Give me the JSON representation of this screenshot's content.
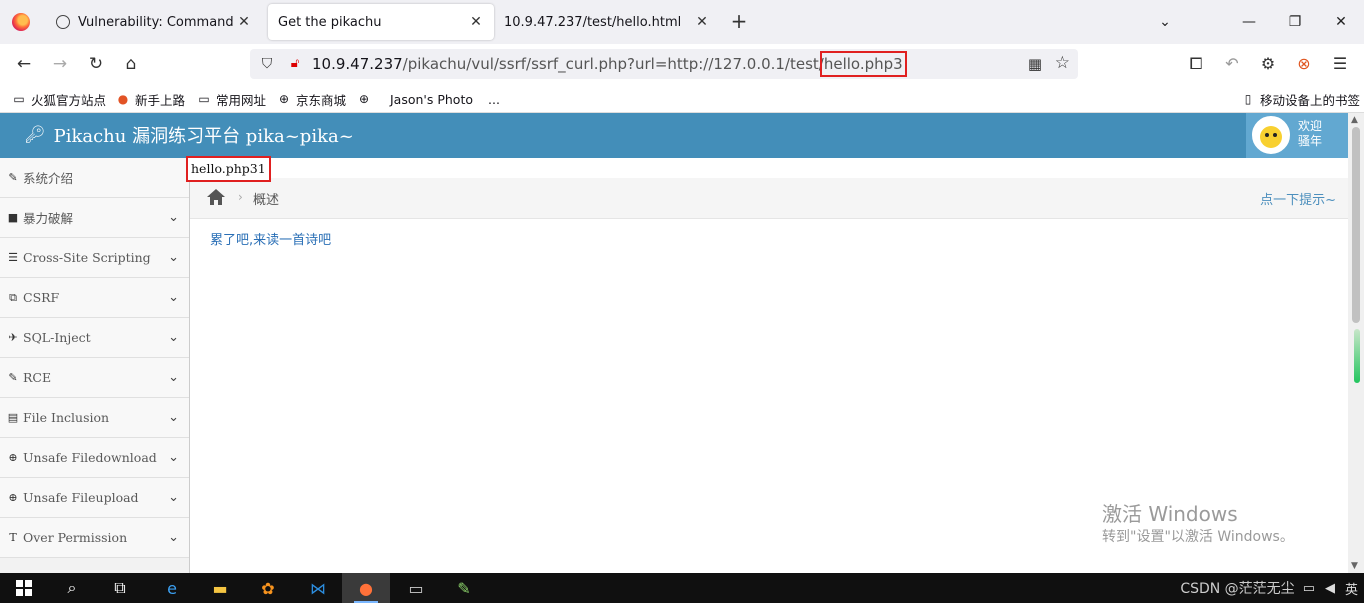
{
  "browser": {
    "tabs": [
      {
        "title": "Vulnerability: Command Injec",
        "active": false
      },
      {
        "title": "Get the pikachu",
        "active": true
      },
      {
        "title": "10.9.47.237/test/hello.html",
        "active": false
      }
    ],
    "url": {
      "host": "10.9.47.237",
      "path": "/pikachu/vul/ssrf/ssrf_curl.php?url=http://127.0.0.1/test/",
      "highlighted": "hello.php3"
    },
    "bookmarks": [
      "火狐官方站点",
      "新手上路",
      "常用网址",
      "京东商城",
      "Jason's Photo",
      "...",
      "移动设备上的书签"
    ]
  },
  "app": {
    "brand": "Pikachu 漏洞练习平台 pika~pika~",
    "welcome_line1": "欢迎",
    "welcome_line2": "骚年",
    "sidebar": [
      {
        "label": "系统介绍",
        "icon": "tags-icon",
        "glyph": "✎",
        "expandable": false
      },
      {
        "label": "暴力破解",
        "icon": "lock-icon",
        "glyph": "■",
        "expandable": true
      },
      {
        "label": "Cross-Site Scripting",
        "icon": "list-icon",
        "glyph": "☰",
        "expandable": true
      },
      {
        "label": "CSRF",
        "icon": "external-link-icon",
        "glyph": "⧉",
        "expandable": true
      },
      {
        "label": "SQL-Inject",
        "icon": "plane-icon",
        "glyph": "✈",
        "expandable": true
      },
      {
        "label": "RCE",
        "icon": "pencil-icon",
        "glyph": "✎",
        "expandable": true
      },
      {
        "label": "File Inclusion",
        "icon": "file-icon",
        "glyph": "▤",
        "expandable": true
      },
      {
        "label": "Unsafe Filedownload",
        "icon": "download-icon",
        "glyph": "⊕",
        "expandable": true
      },
      {
        "label": "Unsafe Fileupload",
        "icon": "upload-icon",
        "glyph": "⊕",
        "expandable": true
      },
      {
        "label": "Over Permission",
        "icon": "text-height-icon",
        "glyph": "T",
        "expandable": true
      }
    ],
    "echo_output": "hello.php31",
    "breadcrumb_current": "概述",
    "hint_link": "点一下提示~",
    "poem_link": "累了吧,来读一首诗吧"
  },
  "os": {
    "watermark_title": "激活 Windows",
    "watermark_sub": "转到\"设置\"以激活 Windows。",
    "tray_text": "CSDN @茫茫无尘",
    "ime": "英"
  }
}
